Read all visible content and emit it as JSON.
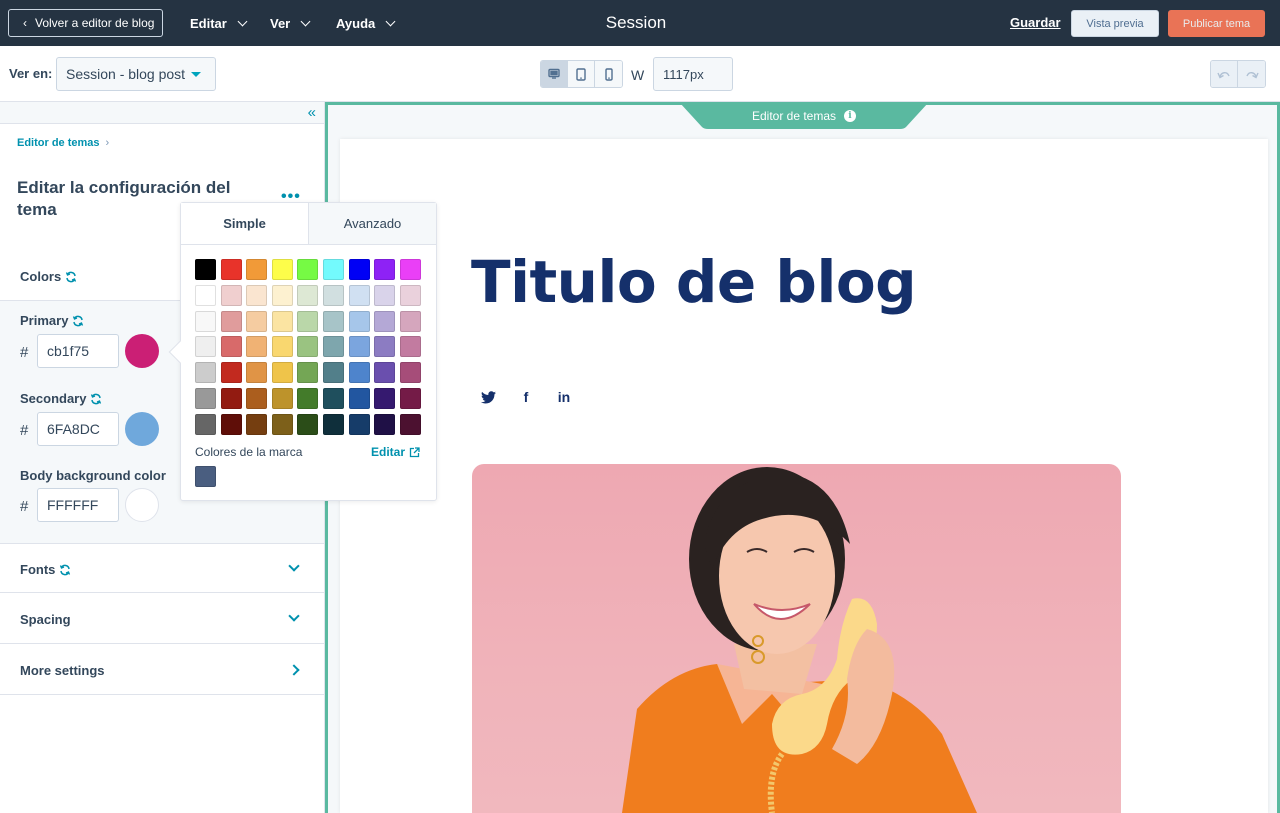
{
  "topbar": {
    "back_label": "Volver a editor de blog",
    "menus": [
      "Editar",
      "Ver",
      "Ayuda"
    ],
    "title": "Session",
    "save_label": "Guardar",
    "preview_label": "Vista previa",
    "publish_label": "Publicar tema"
  },
  "toolbar": {
    "view_on_label": "Ver en:",
    "view_on_value": "Session - blog post",
    "devices": [
      "desktop-icon",
      "tablet-icon",
      "mobile-icon"
    ],
    "active_device": "desktop",
    "width_label": "W",
    "width_value": "1117px"
  },
  "sidebar": {
    "breadcrumb": "Editor de temas",
    "title": "Editar la configuración del tema",
    "more_label": "•••",
    "colors_label": "Colors",
    "colors": [
      {
        "label": "Primary",
        "hex": "cb1f75",
        "swatch": "#cb1f75",
        "sync": true
      },
      {
        "label": "Secondary",
        "hex": "6FA8DC",
        "swatch": "#6FA8DC",
        "sync": true
      },
      {
        "label": "Body background color",
        "hex": "FFFFFF",
        "swatch": "#FFFFFF",
        "sync": false
      }
    ],
    "hash": "#",
    "sections": [
      {
        "label": "Fonts",
        "sync": true,
        "chevron": "down"
      },
      {
        "label": "Spacing",
        "sync": false,
        "chevron": "down"
      },
      {
        "label": "More settings",
        "sync": false,
        "chevron": "right"
      }
    ]
  },
  "picker": {
    "tabs": [
      "Simple",
      "Avanzado"
    ],
    "active_tab": "Simple",
    "palette": [
      [
        "#000000",
        "#e8332a",
        "#f19a38",
        "#fdfd4a",
        "#76fa44",
        "#73fafd",
        "#0000f5",
        "#8e22f5",
        "#ea3ff7"
      ],
      [
        "#ffffff",
        "#f0cfcf",
        "#fae5d0",
        "#fdf1d0",
        "#dde8d4",
        "#d1dfe0",
        "#d0e0f2",
        "#d9d3ea",
        "#ead1dc"
      ],
      [
        "#f8f8f8",
        "#e09c9c",
        "#f5cca1",
        "#fbe4a2",
        "#bad7a9",
        "#a7c4c8",
        "#a6c6ea",
        "#b4a8d6",
        "#d5a6bd"
      ],
      [
        "#efefef",
        "#d86a6a",
        "#f0b274",
        "#f9d76f",
        "#9ac381",
        "#7ea6ad",
        "#7ba5de",
        "#8c7cc2",
        "#c27ba0"
      ],
      [
        "#cccccc",
        "#c22a1f",
        "#e09446",
        "#efc44a",
        "#74a655",
        "#527f8a",
        "#4e84cc",
        "#6a4fae",
        "#a64d79"
      ],
      [
        "#999999",
        "#921b11",
        "#ab5e1e",
        "#bd932b",
        "#437b2a",
        "#1f4f5d",
        "#2256a0",
        "#35196f",
        "#741b47"
      ],
      [
        "#666666",
        "#5f0e08",
        "#753e10",
        "#7d601a",
        "#2b4d18",
        "#0f2f3b",
        "#163c69",
        "#1f1046",
        "#4c1130"
      ]
    ],
    "brand_label": "Colores de la marca",
    "brand_edit_label": "Editar",
    "brand_colors": [
      "#4a5e80"
    ]
  },
  "preview": {
    "editor_tab_label": "Editor de temas",
    "blog_title": "Titulo de blog",
    "social": [
      "twitter-icon",
      "facebook-icon",
      "linkedin-icon"
    ],
    "social_glyphs": [
      "🐦",
      "f",
      "in"
    ],
    "accent": "#5ab9a0"
  }
}
